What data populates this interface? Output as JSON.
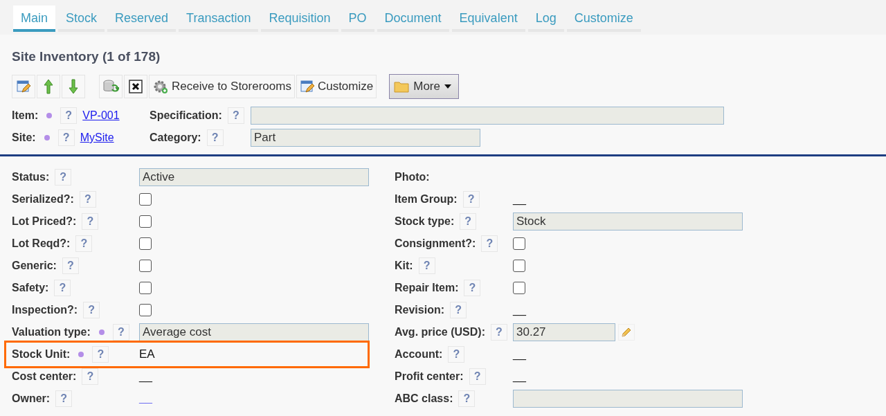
{
  "tabs": [
    {
      "label": "Main",
      "selected": true
    },
    {
      "label": "Stock",
      "selected": false
    },
    {
      "label": "Reserved",
      "selected": false
    },
    {
      "label": "Transaction",
      "selected": false
    },
    {
      "label": "Requisition",
      "selected": false
    },
    {
      "label": "PO",
      "selected": false
    },
    {
      "label": "Document",
      "selected": false
    },
    {
      "label": "Equivalent",
      "selected": false
    },
    {
      "label": "Log",
      "selected": false
    },
    {
      "label": "Customize",
      "selected": false
    }
  ],
  "title": "Site Inventory (1 of 178)",
  "toolbar": {
    "buttons": [
      {
        "label": "Receive to Storerooms"
      },
      {
        "label": "Customize"
      }
    ],
    "more": {
      "label": "More"
    }
  },
  "header": [
    {
      "label": "Item:",
      "required": true,
      "help": "?",
      "link": "VP-001",
      "field_label": "Specification:",
      "field_help": "?"
    },
    {
      "label": "Site:",
      "required": true,
      "help": "?",
      "link": "MySite",
      "field_label": "Category:",
      "field_help": "?",
      "field_value": "Part"
    }
  ],
  "left_fields": [
    {
      "label": "Status:",
      "required": false,
      "help": "?",
      "kind": "field",
      "value": "Active",
      "highlighted": false
    },
    {
      "label": "Serialized?:",
      "required": false,
      "help": "?",
      "kind": "checkbox",
      "checked": false,
      "highlighted": false
    },
    {
      "label": "Lot Priced?:",
      "required": false,
      "help": "?",
      "kind": "checkbox",
      "checked": false,
      "highlighted": false
    },
    {
      "label": "Lot Reqd?:",
      "required": false,
      "help": "?",
      "kind": "checkbox",
      "checked": false,
      "highlighted": false
    },
    {
      "label": "Generic:",
      "required": false,
      "help": "?",
      "kind": "checkbox",
      "checked": false,
      "highlighted": false
    },
    {
      "label": "Safety:",
      "required": false,
      "help": "?",
      "kind": "checkbox",
      "checked": false,
      "highlighted": false
    },
    {
      "label": "Inspection?:",
      "required": false,
      "help": "?",
      "kind": "checkbox",
      "checked": false,
      "highlighted": false
    },
    {
      "label": "Valuation type:",
      "required": true,
      "help": "?",
      "kind": "field",
      "value": "Average cost",
      "highlighted": false
    },
    {
      "label": "Stock Unit:",
      "required": true,
      "help": "?",
      "kind": "text",
      "value": "EA",
      "highlighted": true
    },
    {
      "label": "Cost center:",
      "required": false,
      "help": "?",
      "kind": "text",
      "value": "__",
      "highlighted": false
    },
    {
      "label": "Owner:",
      "required": false,
      "help": "?",
      "kind": "link",
      "value": "__",
      "highlighted": false
    }
  ],
  "right_fields": [
    {
      "label": "Photo:",
      "kind": "none"
    },
    {
      "label": "Item Group:",
      "help": "?",
      "kind": "text",
      "value": "__"
    },
    {
      "label": "Stock type:",
      "help": "?",
      "kind": "field",
      "value": "Stock"
    },
    {
      "label": "Consignment?:",
      "help": "?",
      "kind": "checkbox",
      "checked": false
    },
    {
      "label": "Kit:",
      "help": "?",
      "kind": "checkbox",
      "checked": false
    },
    {
      "label": "Repair Item:",
      "help": "?",
      "kind": "checkbox",
      "checked": false
    },
    {
      "label": "Revision:",
      "help": "?",
      "kind": "text",
      "value": "__"
    },
    {
      "label": "Avg. price (USD):",
      "help": "?",
      "kind": "editable",
      "value": "30.27"
    },
    {
      "label": "Account:",
      "help": "?",
      "kind": "text",
      "value": "__"
    },
    {
      "label": "Profit center:",
      "help": "?",
      "kind": "text",
      "value": "__"
    },
    {
      "label": "ABC class:",
      "help": "?",
      "kind": "field"
    }
  ]
}
